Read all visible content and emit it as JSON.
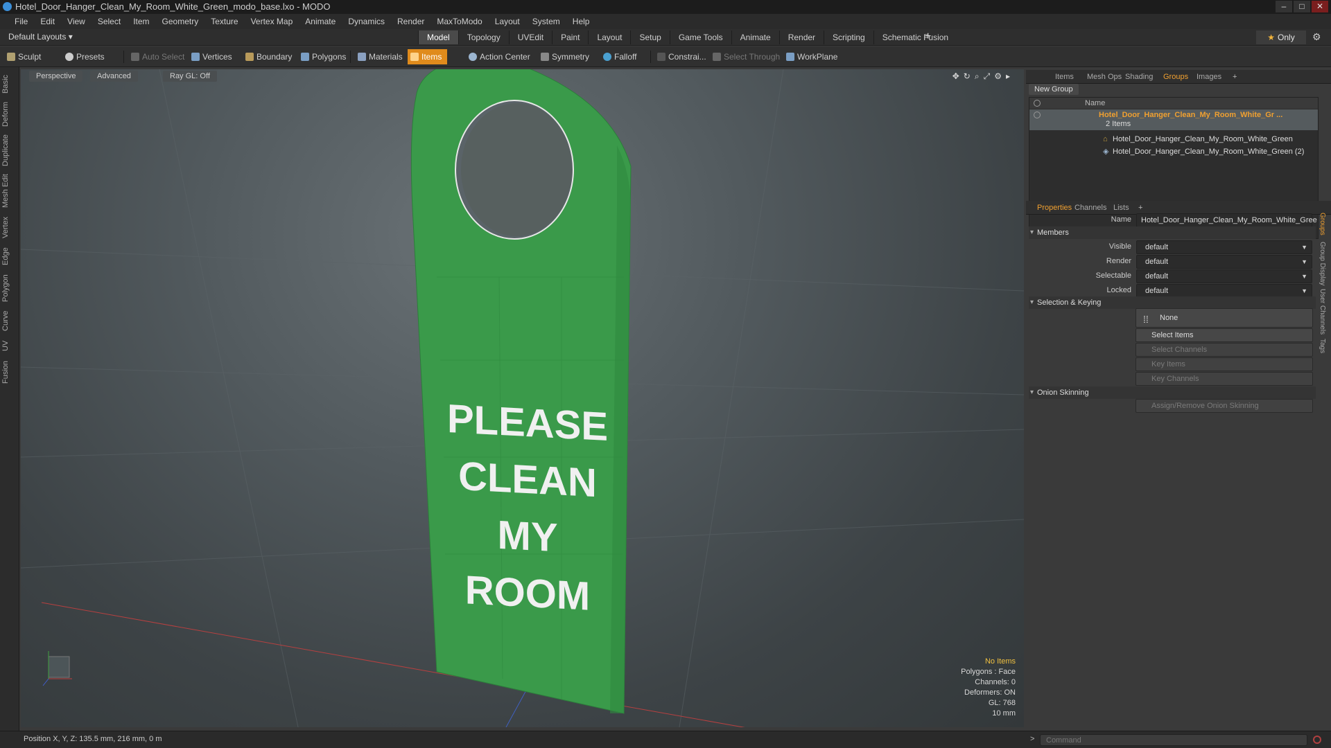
{
  "window": {
    "title": "Hotel_Door_Hanger_Clean_My_Room_White_Green_modo_base.lxo - MODO"
  },
  "menu": [
    "File",
    "Edit",
    "View",
    "Select",
    "Item",
    "Geometry",
    "Texture",
    "Vertex Map",
    "Animate",
    "Dynamics",
    "Render",
    "MaxToModo",
    "Layout",
    "System",
    "Help"
  ],
  "layouts": {
    "label": "Default Layouts ▾"
  },
  "layout_tabs": [
    "Model",
    "Topology",
    "UVEdit",
    "Paint",
    "Layout",
    "Setup",
    "Game Tools",
    "Animate",
    "Render",
    "Scripting",
    "Schematic Fusion"
  ],
  "only_label": "Only",
  "toolbar": {
    "sculpt": "Sculpt",
    "presets": "Presets",
    "auto_select": "Auto Select",
    "vertices": "Vertices",
    "boundary": "Boundary",
    "polygons": "Polygons",
    "materials": "Materials",
    "items": "Items",
    "action_center": "Action Center",
    "symmetry": "Symmetry",
    "falloff": "Falloff",
    "constraints": "Constrai...",
    "select_through": "Select Through",
    "workplane": "WorkPlane"
  },
  "left_tabs": [
    "Basic",
    "Deform",
    "Duplicate",
    "Mesh Edit",
    "Vertex",
    "Edge",
    "Polygon",
    "Curve",
    "UV",
    "Fusion"
  ],
  "viewport": {
    "perspective": "Perspective",
    "advanced": "Advanced",
    "raygl": "Ray GL: Off",
    "sign_lines": [
      "PLEASE",
      "CLEAN",
      "MY",
      "ROOM"
    ],
    "info": {
      "no_items": "No Items",
      "polygons": "Polygons : Face",
      "channels": "Channels: 0",
      "deformers": "Deformers: ON",
      "gl": "GL: 768",
      "scale": "10 mm"
    }
  },
  "panel_tabs_top": [
    "Items",
    "Mesh Ops",
    "Shading",
    "Groups",
    "Images"
  ],
  "groups": {
    "new_group": "New Group",
    "name_header": "Name",
    "group_name": "Hotel_Door_Hanger_Clean_My_Room_White_Gr ...",
    "count": "2 Items",
    "children": [
      "Hotel_Door_Hanger_Clean_My_Room_White_Green",
      "Hotel_Door_Hanger_Clean_My_Room_White_Green (2)"
    ]
  },
  "panel_tabs_bottom": [
    "Properties",
    "Channels",
    "Lists"
  ],
  "properties": {
    "name_label": "Name",
    "name_value": "Hotel_Door_Hanger_Clean_My_Room_White_Gree",
    "members": "Members",
    "visible_label": "Visible",
    "visible": "default",
    "render_label": "Render",
    "render": "default",
    "selectable_label": "Selectable",
    "selectable": "default",
    "locked_label": "Locked",
    "locked": "default",
    "selection_keying": "Selection & Keying",
    "none": "None",
    "select_items": "Select Items",
    "select_channels": "Select Channels",
    "key_items": "Key Items",
    "key_channels": "Key Channels",
    "onion": "Onion Skinning",
    "assign_onion": "Assign/Remove Onion Skinning"
  },
  "side_tabs": [
    "Groups",
    "Group Display",
    "User Channels",
    "Tags"
  ],
  "status": {
    "position": "Position X, Y, Z:  135.5 mm, 216 mm, 0 m",
    "command_placeholder": "Command"
  },
  "colors": {
    "accent": "#e08b1c",
    "sign_green": "#3a9a4a",
    "highlight_text": "#f0a030"
  }
}
